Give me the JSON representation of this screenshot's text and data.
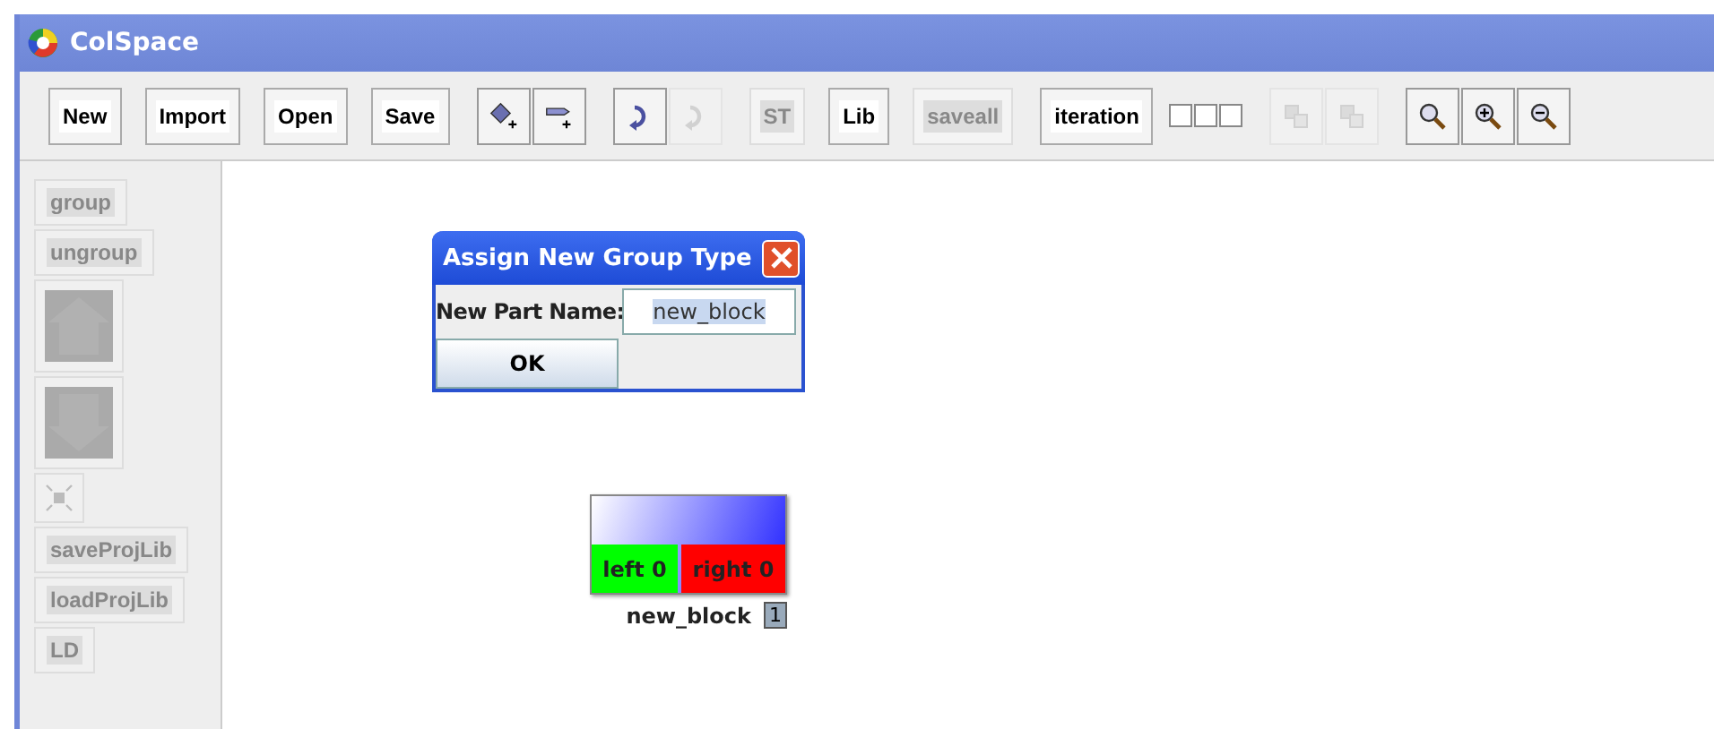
{
  "window": {
    "title": "ColSpace"
  },
  "toolbar": {
    "groups": [
      [
        {
          "kind": "text",
          "label": "New",
          "disabled": false
        },
        {
          "kind": "text",
          "label": "Import",
          "disabled": false
        },
        {
          "kind": "text",
          "label": "Open",
          "disabled": false
        },
        {
          "kind": "text",
          "label": "Save",
          "disabled": false
        }
      ],
      [
        {
          "kind": "icon",
          "disabled": false
        },
        {
          "kind": "icon",
          "disabled": false
        }
      ],
      [
        {
          "kind": "icon",
          "disabled": false
        },
        {
          "kind": "icon",
          "disabled": true
        }
      ],
      [
        {
          "kind": "text",
          "label": "ST",
          "disabled": true
        },
        {
          "kind": "text",
          "label": "Lib",
          "disabled": false
        },
        {
          "kind": "text",
          "label": "saveall",
          "disabled": true
        }
      ],
      [
        {
          "kind": "text",
          "label": "iteration",
          "disabled": false
        },
        {
          "kind": "squares"
        }
      ],
      [
        {
          "kind": "icon",
          "disabled": true
        },
        {
          "kind": "icon",
          "disabled": true
        }
      ],
      [
        {
          "kind": "icon",
          "disabled": false
        },
        {
          "kind": "icon",
          "disabled": false
        },
        {
          "kind": "icon",
          "disabled": false
        }
      ]
    ]
  },
  "sidebar": {
    "items": [
      {
        "kind": "text",
        "label": "group",
        "disabled": true
      },
      {
        "kind": "text",
        "label": "ungroup",
        "disabled": true
      },
      {
        "kind": "arrow",
        "disabled": true
      },
      {
        "kind": "arrow",
        "disabled": true
      },
      {
        "kind": "icon",
        "disabled": true
      },
      {
        "kind": "text",
        "label": "saveProjLib",
        "disabled": true
      },
      {
        "kind": "text",
        "label": "loadProjLib",
        "disabled": true
      },
      {
        "kind": "text",
        "label": "LD",
        "disabled": true
      }
    ]
  },
  "dialog": {
    "title": "Assign New Group Type",
    "field_label": "New Part Name:",
    "field_value": "new_block",
    "button": "OK"
  },
  "block": {
    "ports": [
      {
        "label": "left 0",
        "color": "#00ff00"
      },
      {
        "label": "right 0",
        "color": "#ff0000"
      }
    ],
    "name": "new_block",
    "badge": "1"
  }
}
